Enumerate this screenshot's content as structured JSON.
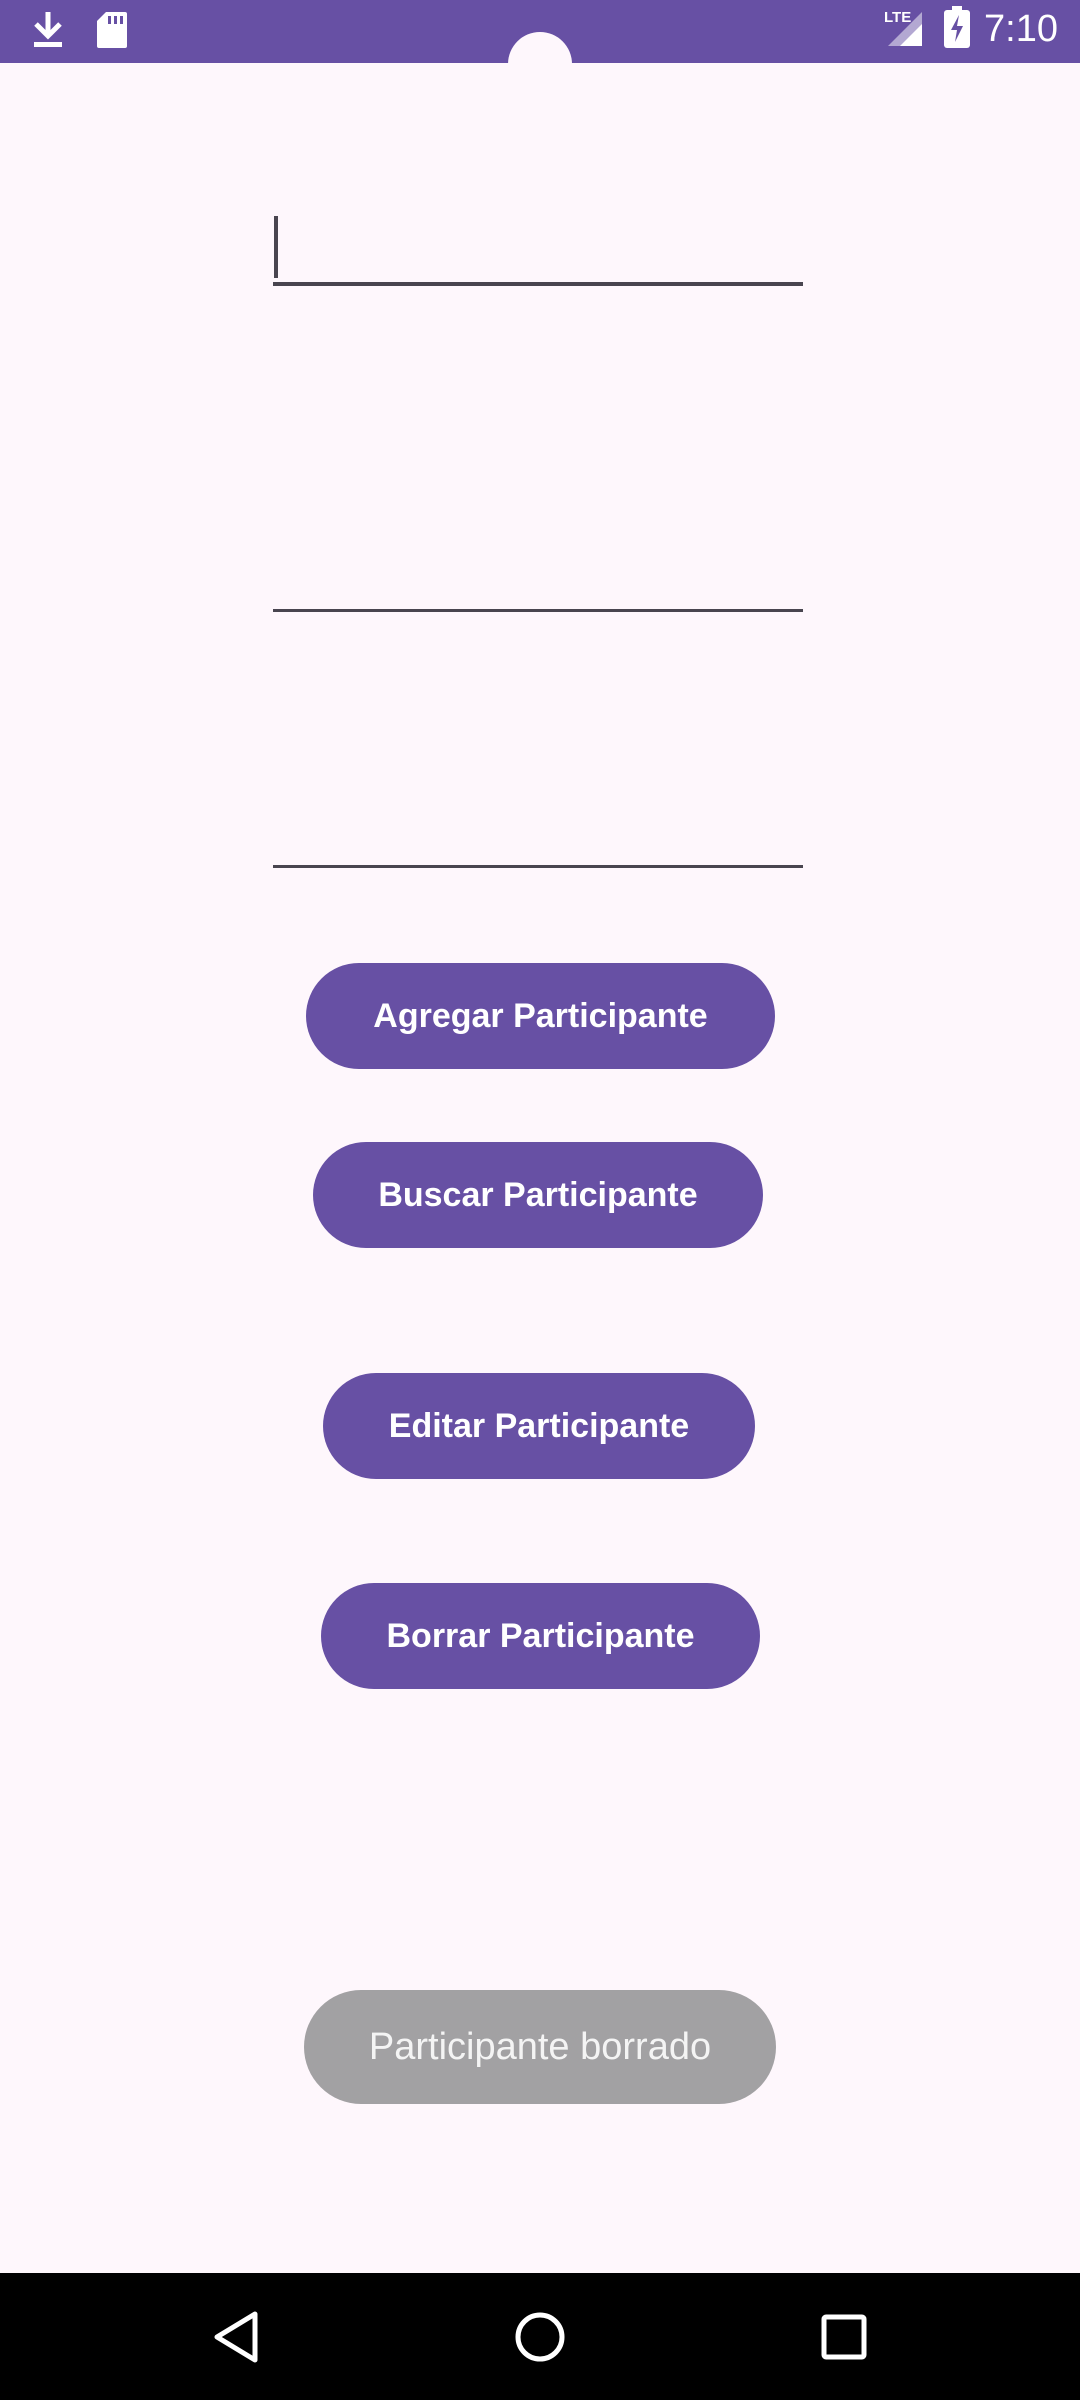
{
  "status_bar": {
    "time": "7:10",
    "network": "LTE",
    "icons": [
      "download-icon",
      "sd-card-icon",
      "signal-icon",
      "battery-charging-icon"
    ]
  },
  "form": {
    "field_1": {
      "value": "",
      "placeholder": ""
    },
    "field_2": {
      "value": "",
      "placeholder": ""
    },
    "field_3": {
      "value": "",
      "placeholder": ""
    }
  },
  "buttons": {
    "agregar": "Agregar Participante",
    "buscar": "Buscar Participante",
    "editar": "Editar Participante",
    "borrar": "Borrar Participante"
  },
  "toast": {
    "message": "Participante borrado"
  },
  "nav_bar": {
    "icons": [
      "back-icon",
      "home-icon",
      "recents-icon"
    ]
  },
  "colors": {
    "primary": "#6750A4",
    "background": "#FEF7FC",
    "toast": "#A2A1A3",
    "nav": "#000000"
  }
}
